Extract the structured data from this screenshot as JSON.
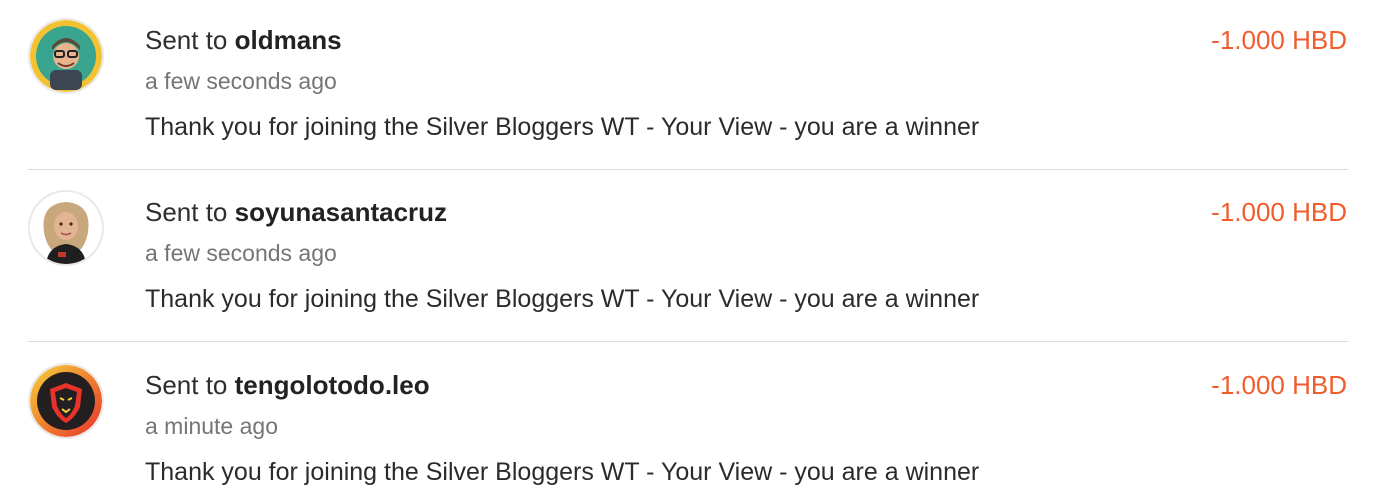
{
  "colors": {
    "amount": "#f15c2c",
    "divider": "#dcdcdc",
    "secondary_text": "#757575"
  },
  "transactions": [
    {
      "avatar_icon": "avatar-oldmans",
      "title_prefix": "Sent to",
      "username": "oldmans",
      "time": "a few seconds ago",
      "memo": "Thank you for joining the Silver Bloggers WT - Your View - you are a winner",
      "amount": "-1.000 HBD"
    },
    {
      "avatar_icon": "avatar-soyunasantacruz",
      "title_prefix": "Sent to",
      "username": "soyunasantacruz",
      "time": "a few seconds ago",
      "memo": "Thank you for joining the Silver Bloggers WT - Your View - you are a winner",
      "amount": "-1.000 HBD"
    },
    {
      "avatar_icon": "avatar-tengolotodo-leo",
      "title_prefix": "Sent to",
      "username": "tengolotodo.leo",
      "time": "a minute ago",
      "memo": "Thank you for joining the Silver Bloggers WT - Your View - you are a winner",
      "amount": "-1.000 HBD"
    }
  ]
}
